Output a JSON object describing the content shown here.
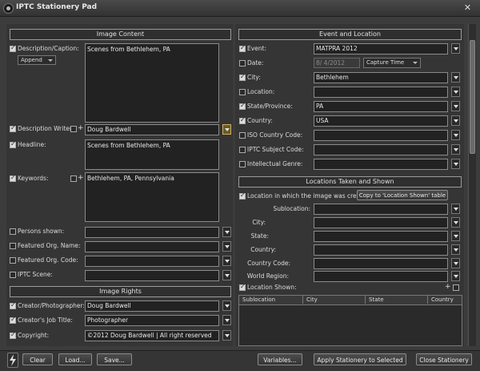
{
  "window": {
    "title": "IPTC Stationery Pad",
    "close_glyph": "✕"
  },
  "image_content": {
    "header": "Image Content",
    "description": {
      "label": "Description/Caption:",
      "checked": true,
      "mode": "Append",
      "value": "Scenes from Bethlehem, PA"
    },
    "writers": {
      "label": "Description Writers:",
      "checked": true,
      "plus": "+",
      "value": "Doug Bardwell"
    },
    "headline": {
      "label": "Headline:",
      "checked": true,
      "value": "Scenes from Bethlehem, PA"
    },
    "keywords": {
      "label": "Keywords:",
      "checked": true,
      "plus": "+",
      "value": "Bethlehem, PA, Pennsylvania"
    },
    "persons": {
      "label": "Persons shown:",
      "checked": false,
      "value": ""
    },
    "org_name": {
      "label": "Featured Org. Name:",
      "checked": false,
      "value": ""
    },
    "org_code": {
      "label": "Featured Org. Code:",
      "checked": false,
      "value": ""
    },
    "iptc_scene": {
      "label": "IPTC Scene:",
      "checked": false,
      "value": ""
    }
  },
  "image_rights": {
    "header": "Image Rights",
    "creator": {
      "label": "Creator/Photographer:",
      "checked": true,
      "value": "Doug Bardwell"
    },
    "job_title": {
      "label": "Creator's Job Title:",
      "checked": true,
      "value": "Photographer"
    },
    "copyright": {
      "label": "Copyright:",
      "checked": true,
      "value": "©2012 Doug Bardwell | All right reserved"
    }
  },
  "event_location": {
    "header": "Event and Location",
    "event": {
      "label": "Event:",
      "checked": true,
      "value": "MATPRA 2012"
    },
    "date": {
      "label": "Date:",
      "checked": false,
      "value": "8/ 4/2012",
      "capture": "Capture Time"
    },
    "city": {
      "label": "City:",
      "checked": true,
      "value": "Bethlehem"
    },
    "location": {
      "label": "Location:",
      "checked": false,
      "value": ""
    },
    "state": {
      "label": "State/Province:",
      "checked": true,
      "value": "PA"
    },
    "country": {
      "label": "Country:",
      "checked": true,
      "value": "USA"
    },
    "iso": {
      "label": "ISO Country Code:",
      "checked": false,
      "value": ""
    },
    "subject": {
      "label": "IPTC Subject Code:",
      "checked": false,
      "value": ""
    },
    "genre": {
      "label": "Intellectual Genre:",
      "checked": false,
      "value": ""
    }
  },
  "locations": {
    "header": "Locations Taken and Shown",
    "created_label": "Location in which the image was created:",
    "copy_button": "Copy to 'Location Shown' table",
    "sublocation": "Sublocation:",
    "city": "City:",
    "state": "State:",
    "country": "Country:",
    "country_code": "Country Code:",
    "world_region": "World Region:",
    "shown_label": "Location Shown:",
    "shown_plus": "+",
    "table_headers": [
      "Sublocation",
      "City",
      "State",
      "Country"
    ]
  },
  "buttons": {
    "clear": "Clear",
    "load": "Load...",
    "save": "Save...",
    "variables": "Variables...",
    "apply": "Apply Stationery to Selected",
    "close": "Close Stationery"
  },
  "icons": {
    "lightning": "lightning-icon"
  }
}
